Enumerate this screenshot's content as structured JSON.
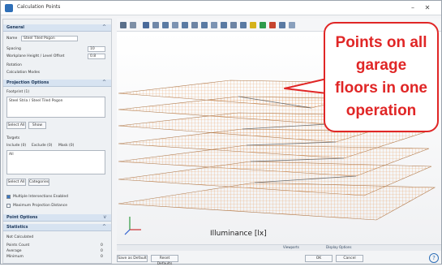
{
  "window": {
    "title": "Calculation Points"
  },
  "left_panel": {
    "sections": {
      "general": "General",
      "projection": "Projection Options",
      "point_options": "Point Options",
      "statistics": "Statistics"
    },
    "general": {
      "name_label": "Name",
      "name_value": "Steel Tiled Pogon",
      "spacing_label": "Spacing",
      "spacing_value": "10",
      "height_label": "Workplane Height / Level Offset",
      "height_value": "0.8",
      "opt1": "Rotation",
      "opt2": "Calculation Modes"
    },
    "projection": {
      "footprint_label": "Footprint (1)",
      "footprint_value": "Steel Stria / Steel Tiled Pogon",
      "select_all": "Select All",
      "show": "Show",
      "targets_label": "Targets",
      "include": "Include (0)",
      "exclude": "Exclude (0)",
      "mask": "Mask (0)",
      "targets_value": "All",
      "select_btn": "Select All",
      "categories_btn": "Categories",
      "multiple_label": "Multiple Intersections Enabled",
      "maximum_label": "Maximum Projection Distance"
    },
    "stats": {
      "calc_label": "Not Calculated",
      "rows": [
        {
          "label": "Points Count",
          "value": "0"
        },
        {
          "label": "Average",
          "value": "0"
        },
        {
          "label": "Minimum",
          "value": "0"
        }
      ]
    }
  },
  "viewport": {
    "legend": "Illuminance [lx]",
    "status_viewports": "Viewports",
    "status_display": "Display Options"
  },
  "bottom_buttons": {
    "save_default": "Save as Default",
    "reset_defaults": "Reset Defaults",
    "ok": "OK",
    "cancel": "Cancel"
  },
  "callout": {
    "lines": [
      "Points on all",
      "garage",
      "floors in one",
      "operation"
    ],
    "color": "#e02626"
  }
}
